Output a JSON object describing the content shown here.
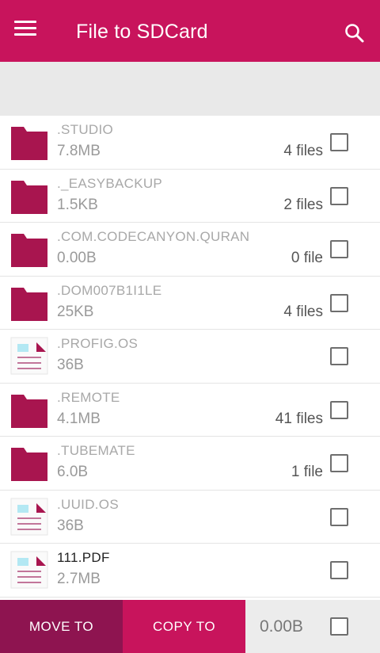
{
  "appbar": {
    "title": "File to SDCard",
    "menu_icon": "menu-icon",
    "search_icon": "search-icon"
  },
  "colors": {
    "primary": "#c8145c",
    "primary_dark": "#8e1450",
    "folder": "#a8154f"
  },
  "files": [
    {
      "name": ".STUDIO",
      "size": "7.8MB",
      "count": "4 files",
      "type": "folder"
    },
    {
      "name": "._EASYBACKUP",
      "size": "1.5KB",
      "count": "2 files",
      "type": "folder"
    },
    {
      "name": ".COM.CODECANYON.QURAN",
      "size": "0.00B",
      "count": "0 file",
      "type": "folder"
    },
    {
      "name": ".DOM007B1I1LE",
      "size": "25KB",
      "count": "4 files",
      "type": "folder"
    },
    {
      "name": ".PROFIG.OS",
      "size": "36B",
      "count": "",
      "type": "file"
    },
    {
      "name": ".REMOTE",
      "size": "4.1MB",
      "count": "41 files",
      "type": "folder"
    },
    {
      "name": ".TUBEMATE",
      "size": "6.0B",
      "count": "1 file",
      "type": "folder"
    },
    {
      "name": ".UUID.OS",
      "size": "36B",
      "count": "",
      "type": "file"
    },
    {
      "name": "111.PDF",
      "size": "2.7MB",
      "count": "",
      "type": "file"
    }
  ],
  "bottom": {
    "move_label": "MOVE TO",
    "copy_label": "COPY TO",
    "total_size": "0.00B"
  }
}
